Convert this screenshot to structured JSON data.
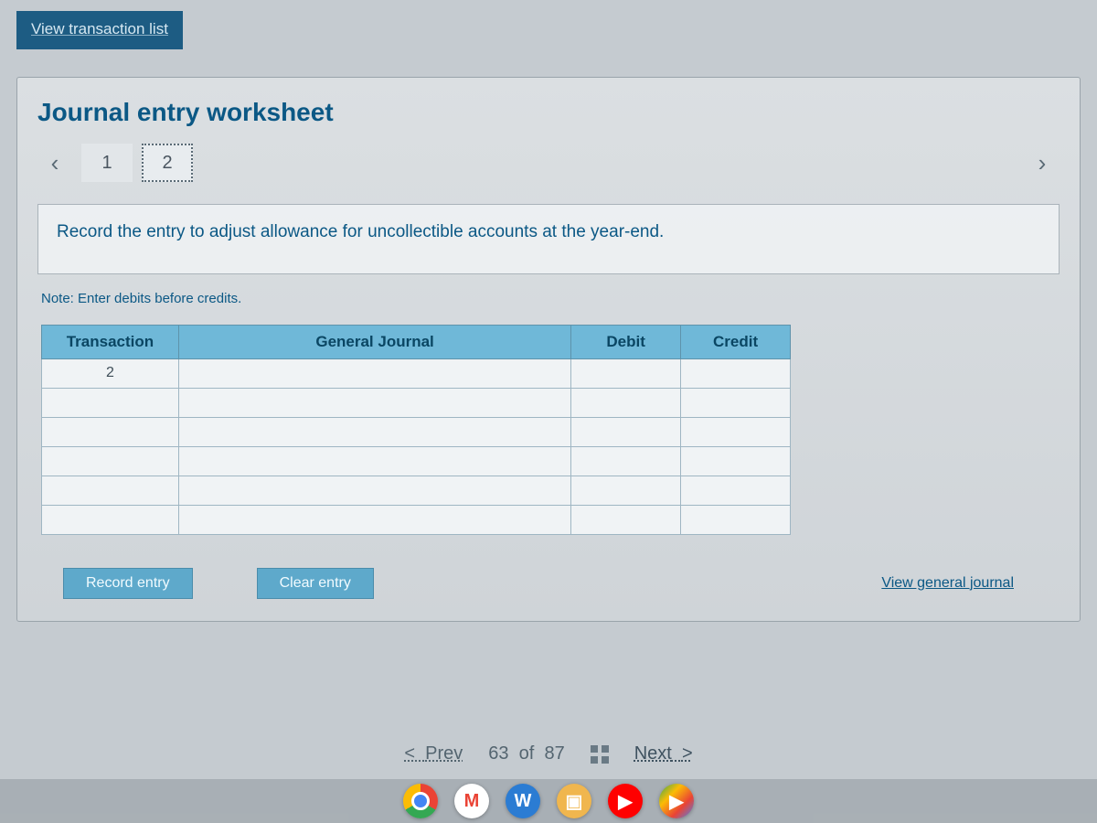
{
  "header": {
    "view_transaction_list": "View transaction list"
  },
  "worksheet": {
    "title": "Journal entry worksheet",
    "tabs": [
      "1",
      "2"
    ],
    "active_tab_index": 1,
    "instruction": "Record the entry to adjust allowance for uncollectible accounts at the year-end.",
    "note": "Note: Enter debits before credits.",
    "columns": {
      "transaction": "Transaction",
      "general_journal": "General Journal",
      "debit": "Debit",
      "credit": "Credit"
    },
    "rows": [
      {
        "transaction": "2",
        "general_journal": "",
        "debit": "",
        "credit": ""
      },
      {
        "transaction": "",
        "general_journal": "",
        "debit": "",
        "credit": ""
      },
      {
        "transaction": "",
        "general_journal": "",
        "debit": "",
        "credit": ""
      },
      {
        "transaction": "",
        "general_journal": "",
        "debit": "",
        "credit": ""
      },
      {
        "transaction": "",
        "general_journal": "",
        "debit": "",
        "credit": ""
      },
      {
        "transaction": "",
        "general_journal": "",
        "debit": "",
        "credit": ""
      }
    ],
    "buttons": {
      "record": "Record entry",
      "clear": "Clear entry",
      "view_journal": "View general journal"
    }
  },
  "footer": {
    "prev": "Prev",
    "next": "Next",
    "page_current": "63",
    "page_sep": "of",
    "page_total": "87",
    "prev_glyph": "<",
    "next_glyph": ">"
  },
  "nav_glyphs": {
    "left": "‹",
    "right": "›"
  },
  "taskbar": {
    "gmail_glyph": "M",
    "word_glyph": "W",
    "folder_glyph": "▣",
    "yt_glyph": "▶",
    "play_glyph": "▶"
  }
}
